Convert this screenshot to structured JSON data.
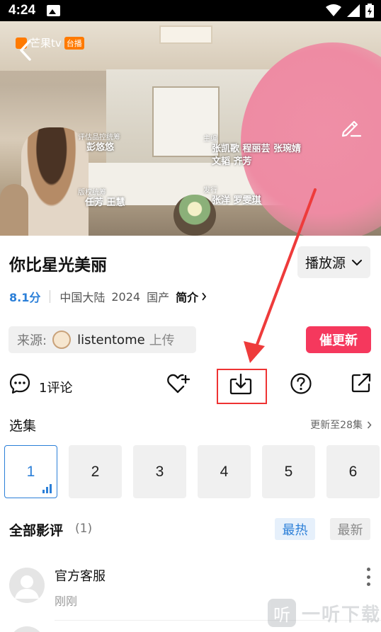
{
  "status_bar": {
    "time": "4:24"
  },
  "video": {
    "logo_text": "芒果tv",
    "logo_badge": "台播",
    "credits": [
      {
        "role": "评估品控统筹",
        "names": "彭悠悠"
      },
      {
        "role": "版权统筹",
        "names": "任芳 王慧"
      },
      {
        "role": "主编",
        "names": "张凯歌 程丽芸 张琬婧\n文韬 齐芳"
      },
      {
        "role": "发行",
        "names": "张洋 罗雯琪"
      }
    ]
  },
  "show": {
    "title": "你比星光美丽",
    "source_button": "播放源",
    "score": "8.1分",
    "region": "中国大陆",
    "year": "2024",
    "origin": "国产",
    "intro": "简介"
  },
  "uploader": {
    "label": "来源:",
    "name": "listentome",
    "action": "上传"
  },
  "update_button": "催更新",
  "actions": {
    "comment_label": "1评论"
  },
  "episodes": {
    "title": "选集",
    "update_info": "更新至28集",
    "items": [
      "1",
      "2",
      "3",
      "4",
      "5",
      "6"
    ],
    "selected": "1"
  },
  "reviews": {
    "title": "全部影评",
    "count": "(1)",
    "sort_hot": "最热",
    "sort_new": "最新",
    "items": [
      {
        "name": "官方客服",
        "time": "刚刚"
      }
    ]
  },
  "watermark": {
    "icon_char": "听",
    "text": "一听下载"
  },
  "colors": {
    "accent_blue": "#2b7fd8",
    "urge_red": "#f5385d",
    "highlight_red": "#e33333"
  }
}
